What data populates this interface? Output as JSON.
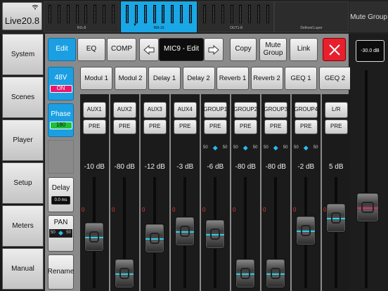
{
  "app": {
    "title": "Live20.8"
  },
  "layers": [
    {
      "label": "IN1-8",
      "selected": false
    },
    {
      "label": "IN9-16",
      "selected": true
    },
    {
      "label": "OUT1-8",
      "selected": false
    },
    {
      "label": "Defined Layer",
      "selected": false
    }
  ],
  "mute_group_top": "Mute Group",
  "nav": [
    "System",
    "Scenes",
    "Player",
    "Setup",
    "Meters",
    "Manual"
  ],
  "toolbar": {
    "edit": "Edit",
    "eq": "EQ",
    "comp": "COMP",
    "channel": "MIC9 - Edit",
    "copy": "Copy",
    "mute_group": "Mute Group",
    "link": "Link"
  },
  "side": {
    "48v": "48V",
    "48v_state": "ON",
    "phase": "Phase",
    "phase_value": "180",
    "delay": "Delay",
    "delay_value": "0.0 ms",
    "pan": "PAN",
    "pan_left": "50",
    "pan_right": "50",
    "rename": "Rename"
  },
  "fx": [
    "Modul 1",
    "Modul 2",
    "Delay 1",
    "Delay 2",
    "Reverb 1",
    "Reverb 2",
    "GEQ 1",
    "GEQ 2"
  ],
  "sends": [
    {
      "name": "AUX1",
      "tap": "PRE",
      "level": "-10 dB",
      "fader": 0.45,
      "pan": false
    },
    {
      "name": "AUX2",
      "tap": "PRE",
      "level": "-80 dB",
      "fader": 0.0,
      "pan": false
    },
    {
      "name": "AUX3",
      "tap": "PRE",
      "level": "-12 dB",
      "fader": 0.43,
      "pan": false
    },
    {
      "name": "AUX4",
      "tap": "PRE",
      "level": "-3 dB",
      "fader": 0.52,
      "pan": false
    },
    {
      "name": "GROUP1",
      "tap": "PRE",
      "level": "-6 dB",
      "fader": 0.48,
      "pan": true,
      "pan_l": "50",
      "pan_r": "50"
    },
    {
      "name": "GROUP2",
      "tap": "PRE",
      "level": "-80 dB",
      "fader": 0.0,
      "pan": true,
      "pan_l": "50",
      "pan_r": "50"
    },
    {
      "name": "GROUP3",
      "tap": "PRE",
      "level": "-80 dB",
      "fader": 0.0,
      "pan": true,
      "pan_l": "50",
      "pan_r": "50"
    },
    {
      "name": "GROUP4",
      "tap": "PRE",
      "level": "-2 dB",
      "fader": 0.53,
      "pan": true,
      "pan_l": "50",
      "pan_r": "50"
    },
    {
      "name": "L/R",
      "tap": "PRE",
      "level": "5 dB",
      "fader": 0.68,
      "pan": false
    }
  ],
  "zero_label": "0",
  "main": {
    "level": "-30.0 dB",
    "fader": 0.35
  },
  "colors": {
    "accent": "#1c9fe2",
    "on_badge": "#e8186c",
    "phase_badge": "#1fbf3a",
    "close": "#e81f2c",
    "main_fader_line": "#e02a6a"
  }
}
